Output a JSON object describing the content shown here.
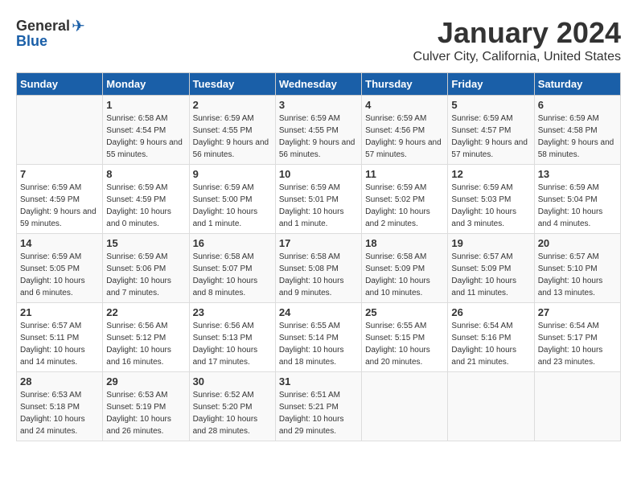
{
  "header": {
    "logo_general": "General",
    "logo_blue": "Blue",
    "month_title": "January 2024",
    "location": "Culver City, California, United States"
  },
  "days_of_week": [
    "Sunday",
    "Monday",
    "Tuesday",
    "Wednesday",
    "Thursday",
    "Friday",
    "Saturday"
  ],
  "weeks": [
    [
      {
        "day": "",
        "sunrise": "",
        "sunset": "",
        "daylight": ""
      },
      {
        "day": "1",
        "sunrise": "Sunrise: 6:58 AM",
        "sunset": "Sunset: 4:54 PM",
        "daylight": "Daylight: 9 hours and 55 minutes."
      },
      {
        "day": "2",
        "sunrise": "Sunrise: 6:59 AM",
        "sunset": "Sunset: 4:55 PM",
        "daylight": "Daylight: 9 hours and 56 minutes."
      },
      {
        "day": "3",
        "sunrise": "Sunrise: 6:59 AM",
        "sunset": "Sunset: 4:55 PM",
        "daylight": "Daylight: 9 hours and 56 minutes."
      },
      {
        "day": "4",
        "sunrise": "Sunrise: 6:59 AM",
        "sunset": "Sunset: 4:56 PM",
        "daylight": "Daylight: 9 hours and 57 minutes."
      },
      {
        "day": "5",
        "sunrise": "Sunrise: 6:59 AM",
        "sunset": "Sunset: 4:57 PM",
        "daylight": "Daylight: 9 hours and 57 minutes."
      },
      {
        "day": "6",
        "sunrise": "Sunrise: 6:59 AM",
        "sunset": "Sunset: 4:58 PM",
        "daylight": "Daylight: 9 hours and 58 minutes."
      }
    ],
    [
      {
        "day": "7",
        "sunrise": "Sunrise: 6:59 AM",
        "sunset": "Sunset: 4:59 PM",
        "daylight": "Daylight: 9 hours and 59 minutes."
      },
      {
        "day": "8",
        "sunrise": "Sunrise: 6:59 AM",
        "sunset": "Sunset: 4:59 PM",
        "daylight": "Daylight: 10 hours and 0 minutes."
      },
      {
        "day": "9",
        "sunrise": "Sunrise: 6:59 AM",
        "sunset": "Sunset: 5:00 PM",
        "daylight": "Daylight: 10 hours and 1 minute."
      },
      {
        "day": "10",
        "sunrise": "Sunrise: 6:59 AM",
        "sunset": "Sunset: 5:01 PM",
        "daylight": "Daylight: 10 hours and 1 minute."
      },
      {
        "day": "11",
        "sunrise": "Sunrise: 6:59 AM",
        "sunset": "Sunset: 5:02 PM",
        "daylight": "Daylight: 10 hours and 2 minutes."
      },
      {
        "day": "12",
        "sunrise": "Sunrise: 6:59 AM",
        "sunset": "Sunset: 5:03 PM",
        "daylight": "Daylight: 10 hours and 3 minutes."
      },
      {
        "day": "13",
        "sunrise": "Sunrise: 6:59 AM",
        "sunset": "Sunset: 5:04 PM",
        "daylight": "Daylight: 10 hours and 4 minutes."
      }
    ],
    [
      {
        "day": "14",
        "sunrise": "Sunrise: 6:59 AM",
        "sunset": "Sunset: 5:05 PM",
        "daylight": "Daylight: 10 hours and 6 minutes."
      },
      {
        "day": "15",
        "sunrise": "Sunrise: 6:59 AM",
        "sunset": "Sunset: 5:06 PM",
        "daylight": "Daylight: 10 hours and 7 minutes."
      },
      {
        "day": "16",
        "sunrise": "Sunrise: 6:58 AM",
        "sunset": "Sunset: 5:07 PM",
        "daylight": "Daylight: 10 hours and 8 minutes."
      },
      {
        "day": "17",
        "sunrise": "Sunrise: 6:58 AM",
        "sunset": "Sunset: 5:08 PM",
        "daylight": "Daylight: 10 hours and 9 minutes."
      },
      {
        "day": "18",
        "sunrise": "Sunrise: 6:58 AM",
        "sunset": "Sunset: 5:09 PM",
        "daylight": "Daylight: 10 hours and 10 minutes."
      },
      {
        "day": "19",
        "sunrise": "Sunrise: 6:57 AM",
        "sunset": "Sunset: 5:09 PM",
        "daylight": "Daylight: 10 hours and 11 minutes."
      },
      {
        "day": "20",
        "sunrise": "Sunrise: 6:57 AM",
        "sunset": "Sunset: 5:10 PM",
        "daylight": "Daylight: 10 hours and 13 minutes."
      }
    ],
    [
      {
        "day": "21",
        "sunrise": "Sunrise: 6:57 AM",
        "sunset": "Sunset: 5:11 PM",
        "daylight": "Daylight: 10 hours and 14 minutes."
      },
      {
        "day": "22",
        "sunrise": "Sunrise: 6:56 AM",
        "sunset": "Sunset: 5:12 PM",
        "daylight": "Daylight: 10 hours and 16 minutes."
      },
      {
        "day": "23",
        "sunrise": "Sunrise: 6:56 AM",
        "sunset": "Sunset: 5:13 PM",
        "daylight": "Daylight: 10 hours and 17 minutes."
      },
      {
        "day": "24",
        "sunrise": "Sunrise: 6:55 AM",
        "sunset": "Sunset: 5:14 PM",
        "daylight": "Daylight: 10 hours and 18 minutes."
      },
      {
        "day": "25",
        "sunrise": "Sunrise: 6:55 AM",
        "sunset": "Sunset: 5:15 PM",
        "daylight": "Daylight: 10 hours and 20 minutes."
      },
      {
        "day": "26",
        "sunrise": "Sunrise: 6:54 AM",
        "sunset": "Sunset: 5:16 PM",
        "daylight": "Daylight: 10 hours and 21 minutes."
      },
      {
        "day": "27",
        "sunrise": "Sunrise: 6:54 AM",
        "sunset": "Sunset: 5:17 PM",
        "daylight": "Daylight: 10 hours and 23 minutes."
      }
    ],
    [
      {
        "day": "28",
        "sunrise": "Sunrise: 6:53 AM",
        "sunset": "Sunset: 5:18 PM",
        "daylight": "Daylight: 10 hours and 24 minutes."
      },
      {
        "day": "29",
        "sunrise": "Sunrise: 6:53 AM",
        "sunset": "Sunset: 5:19 PM",
        "daylight": "Daylight: 10 hours and 26 minutes."
      },
      {
        "day": "30",
        "sunrise": "Sunrise: 6:52 AM",
        "sunset": "Sunset: 5:20 PM",
        "daylight": "Daylight: 10 hours and 28 minutes."
      },
      {
        "day": "31",
        "sunrise": "Sunrise: 6:51 AM",
        "sunset": "Sunset: 5:21 PM",
        "daylight": "Daylight: 10 hours and 29 minutes."
      },
      {
        "day": "",
        "sunrise": "",
        "sunset": "",
        "daylight": ""
      },
      {
        "day": "",
        "sunrise": "",
        "sunset": "",
        "daylight": ""
      },
      {
        "day": "",
        "sunrise": "",
        "sunset": "",
        "daylight": ""
      }
    ]
  ]
}
